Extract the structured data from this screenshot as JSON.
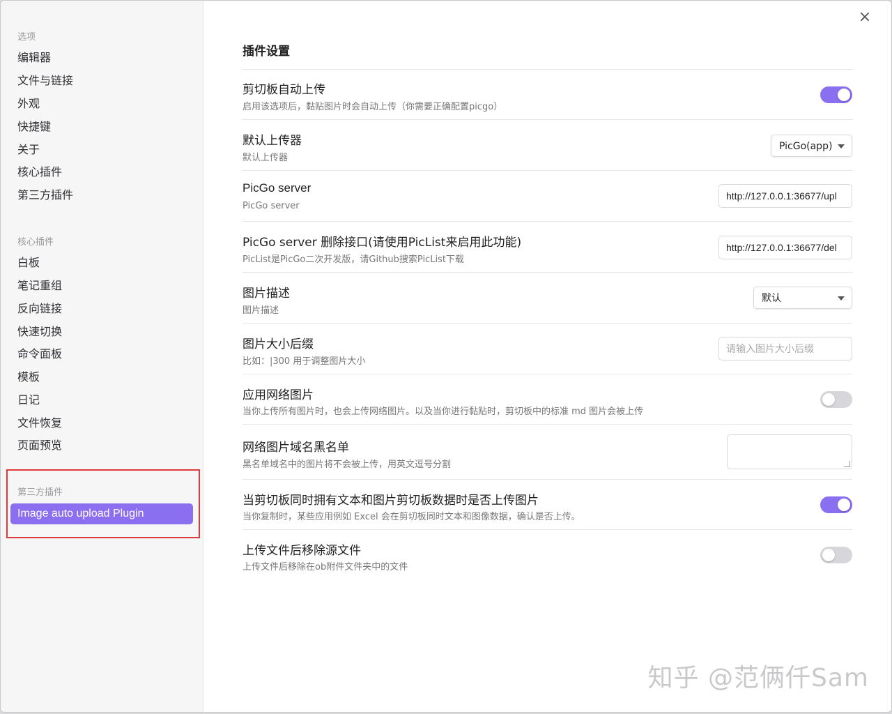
{
  "sidebar": {
    "options_title": "选项",
    "options": [
      "编辑器",
      "文件与链接",
      "外观",
      "快捷键",
      "关于",
      "核心插件",
      "第三方插件"
    ],
    "core_title": "核心插件",
    "core": [
      "白板",
      "笔记重组",
      "反向链接",
      "快速切换",
      "命令面板",
      "模板",
      "日记",
      "文件恢复",
      "页面预览"
    ],
    "third_title": "第三方插件",
    "third_active": "Image auto upload Plugin"
  },
  "main": {
    "title": "插件设置",
    "close_icon": "×",
    "settings": [
      {
        "name": "剪切板自动上传",
        "desc": "启用该选项后，黏贴图片时会自动上传（你需要正确配置picgo）",
        "control": "toggle",
        "on": true
      },
      {
        "name": "默认上传器",
        "desc": "默认上传器",
        "control": "select",
        "value": "PicGo(app)"
      },
      {
        "name": "PicGo server",
        "desc": "PicGo server",
        "control": "input",
        "value": "http://127.0.0.1:36677/upl"
      },
      {
        "name": "PicGo server 删除接口(请使用PicList来启用此功能)",
        "desc": "PicList是PicGo二次开发版，请Github搜索PicList下载",
        "control": "input",
        "value": "http://127.0.0.1:36677/del"
      },
      {
        "name": "图片描述",
        "desc": "图片描述",
        "control": "select",
        "value": "默认"
      },
      {
        "name": "图片大小后缀",
        "desc": "比如：|300 用于调整图片大小",
        "control": "input",
        "placeholder": "请输入图片大小后缀"
      },
      {
        "name": "应用网络图片",
        "desc": "当你上传所有图片时，也会上传网络图片。以及当你进行黏贴时，剪切板中的标准 md 图片会被上传",
        "control": "toggle",
        "on": false
      },
      {
        "name": "网络图片域名黑名单",
        "desc": "黑名单域名中的图片将不会被上传，用英文逗号分割",
        "control": "textarea"
      },
      {
        "name": "当剪切板同时拥有文本和图片剪切板数据时是否上传图片",
        "desc": "当你复制时，某些应用例如 Excel 会在剪切板同时文本和图像数据，确认是否上传。",
        "control": "toggle",
        "on": true
      },
      {
        "name": "上传文件后移除源文件",
        "desc": "上传文件后移除在ob附件文件夹中的文件",
        "control": "toggle",
        "on": false
      }
    ]
  },
  "watermark": "知乎 @范俩仟Sam",
  "colors": {
    "accent": "#8a6ff0",
    "highlight": "#e03a3a"
  }
}
